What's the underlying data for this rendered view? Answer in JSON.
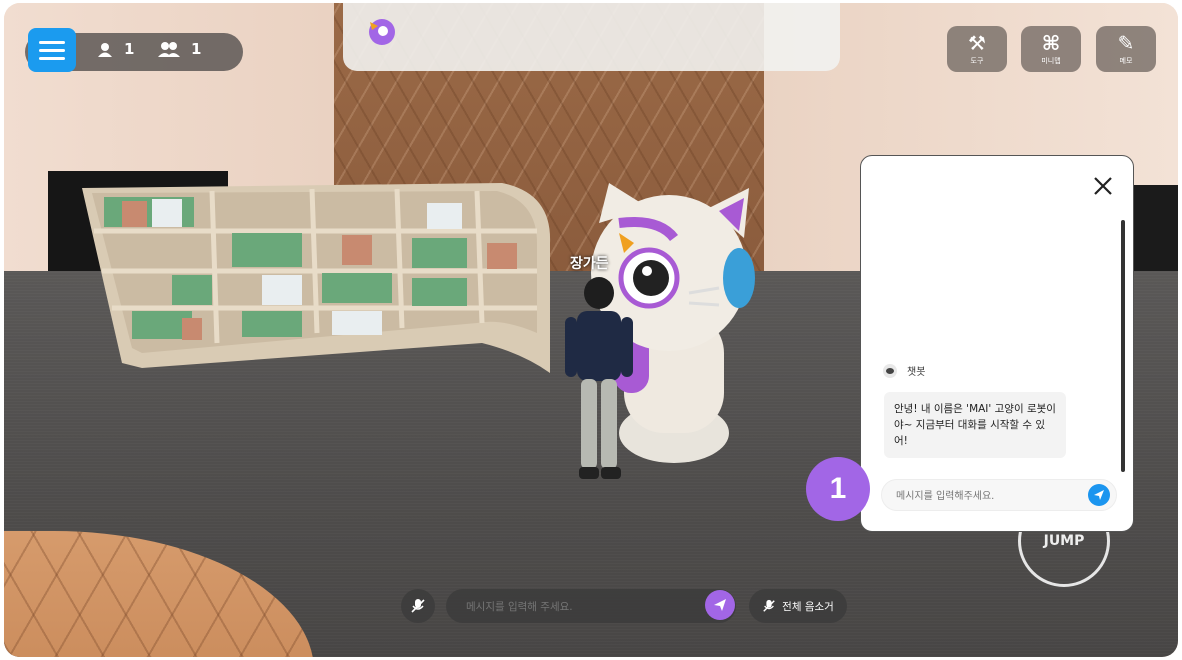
{
  "hud": {
    "users_count": "1",
    "people_count": "1"
  },
  "tools": [
    {
      "label": "도구",
      "icon": "tools-icon"
    },
    {
      "label": "미니맵",
      "icon": "minimap-icon"
    },
    {
      "label": "메모",
      "icon": "memo-icon"
    }
  ],
  "scene": {
    "player_name": "장가든",
    "jump_label": "JUMP"
  },
  "chat": {
    "bot_name": "챗봇",
    "bot_message": "안녕! 내 이름은 'MAI' 고양이 로봇이야~ 지금부터 대화를 시작할 수 있어!",
    "input_placeholder": "메시지를 입력해주세요.",
    "step_number": "1"
  },
  "bottom_bar": {
    "message_placeholder": "메시지를 입력해 주세요.",
    "mute_all_label": "전체 음소거"
  },
  "colors": {
    "menu_blue": "#1b9bef",
    "accent_purple": "#a266e6",
    "send_blue": "#1b95ef"
  }
}
